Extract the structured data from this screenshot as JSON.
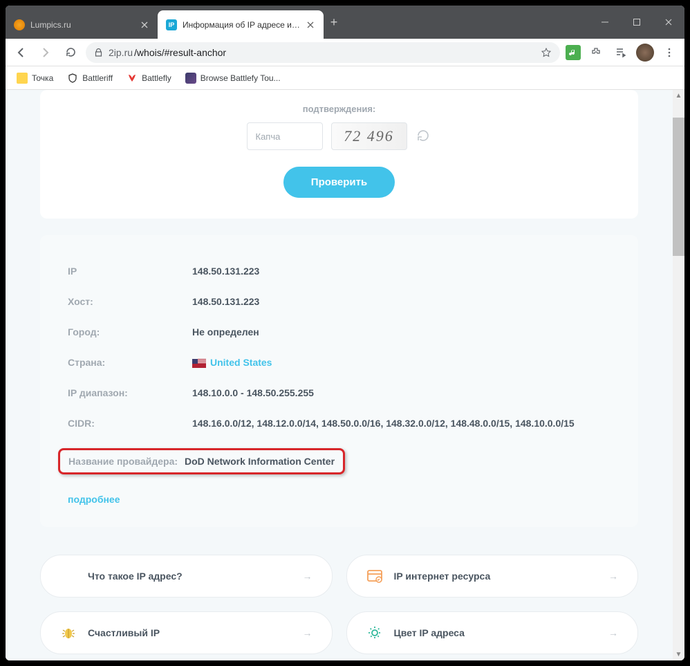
{
  "tabs": [
    {
      "title": "Lumpics.ru",
      "active": false
    },
    {
      "title": "Информация об IP адресе или",
      "active": true
    }
  ],
  "url_host": "2ip.ru",
  "url_path": "/whois/#result-anchor",
  "bookmarks": [
    {
      "label": "Точка"
    },
    {
      "label": "Battleriff"
    },
    {
      "label": "Battlefly"
    },
    {
      "label": "Browse Battlefy Tou..."
    }
  ],
  "form": {
    "confirm_label": "подтверждения:",
    "captcha_placeholder": "Капча",
    "captcha_text": "72 496",
    "submit": "Проверить"
  },
  "results": {
    "ip_label": "IP",
    "ip_value": "148.50.131.223",
    "host_label": "Хост:",
    "host_value": "148.50.131.223",
    "city_label": "Город:",
    "city_value": "Не определен",
    "country_label": "Страна:",
    "country_value": "United States",
    "range_label": "IP диапазон:",
    "range_value": "148.10.0.0 - 148.50.255.255",
    "cidr_label": "CIDR:",
    "cidr_value": "148.16.0.0/12, 148.12.0.0/14, 148.50.0.0/16, 148.32.0.0/12, 148.48.0.0/15, 148.10.0.0/15",
    "provider_label": "Название провайдера:",
    "provider_value": "DoD Network Information Center",
    "more": "подробнее"
  },
  "quick": [
    {
      "label": "Что такое IP адрес?"
    },
    {
      "label": "IP интернет ресурса"
    },
    {
      "label": "Счастливый IP"
    },
    {
      "label": "Цвет IP адреса"
    }
  ]
}
